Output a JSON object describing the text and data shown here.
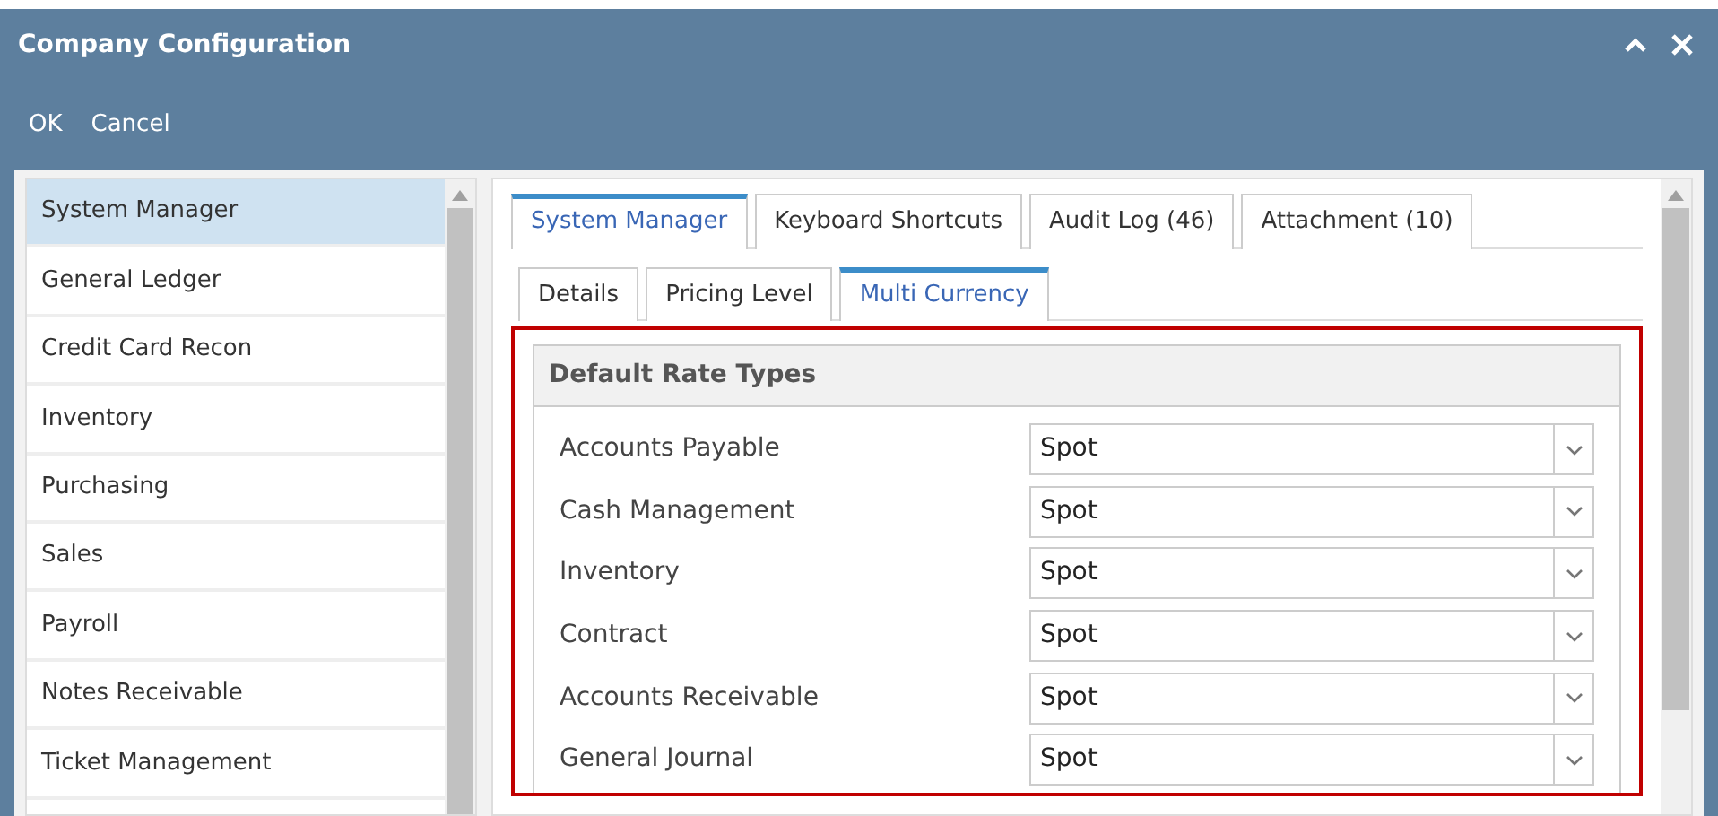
{
  "window": {
    "title": "Company Configuration"
  },
  "toolbar": [
    "OK",
    "Cancel"
  ],
  "sidebar": {
    "items": [
      {
        "label": "System Manager",
        "selected": true
      },
      {
        "label": "General Ledger",
        "selected": false
      },
      {
        "label": "Credit Card Recon",
        "selected": false
      },
      {
        "label": "Inventory",
        "selected": false
      },
      {
        "label": "Purchasing",
        "selected": false
      },
      {
        "label": "Sales",
        "selected": false
      },
      {
        "label": "Payroll",
        "selected": false
      },
      {
        "label": "Notes Receivable",
        "selected": false
      },
      {
        "label": "Ticket Management",
        "selected": false
      }
    ]
  },
  "tabs": [
    {
      "label": "System Manager",
      "selected": true
    },
    {
      "label": "Keyboard Shortcuts",
      "selected": false
    },
    {
      "label": "Audit Log (46)",
      "selected": false
    },
    {
      "label": "Attachment (10)",
      "selected": false
    }
  ],
  "subtabs": [
    {
      "label": "Details",
      "selected": false
    },
    {
      "label": "Pricing Level",
      "selected": false
    },
    {
      "label": "Multi Currency",
      "selected": true
    }
  ],
  "panel": {
    "title": "Default Rate Types",
    "fields": [
      {
        "label": "Accounts Payable",
        "value": "Spot"
      },
      {
        "label": "Cash Management",
        "value": "Spot"
      },
      {
        "label": "Inventory",
        "value": "Spot"
      },
      {
        "label": "Contract",
        "value": "Spot"
      },
      {
        "label": "Accounts Receivable",
        "value": "Spot"
      },
      {
        "label": "General Journal",
        "value": "Spot"
      }
    ]
  }
}
